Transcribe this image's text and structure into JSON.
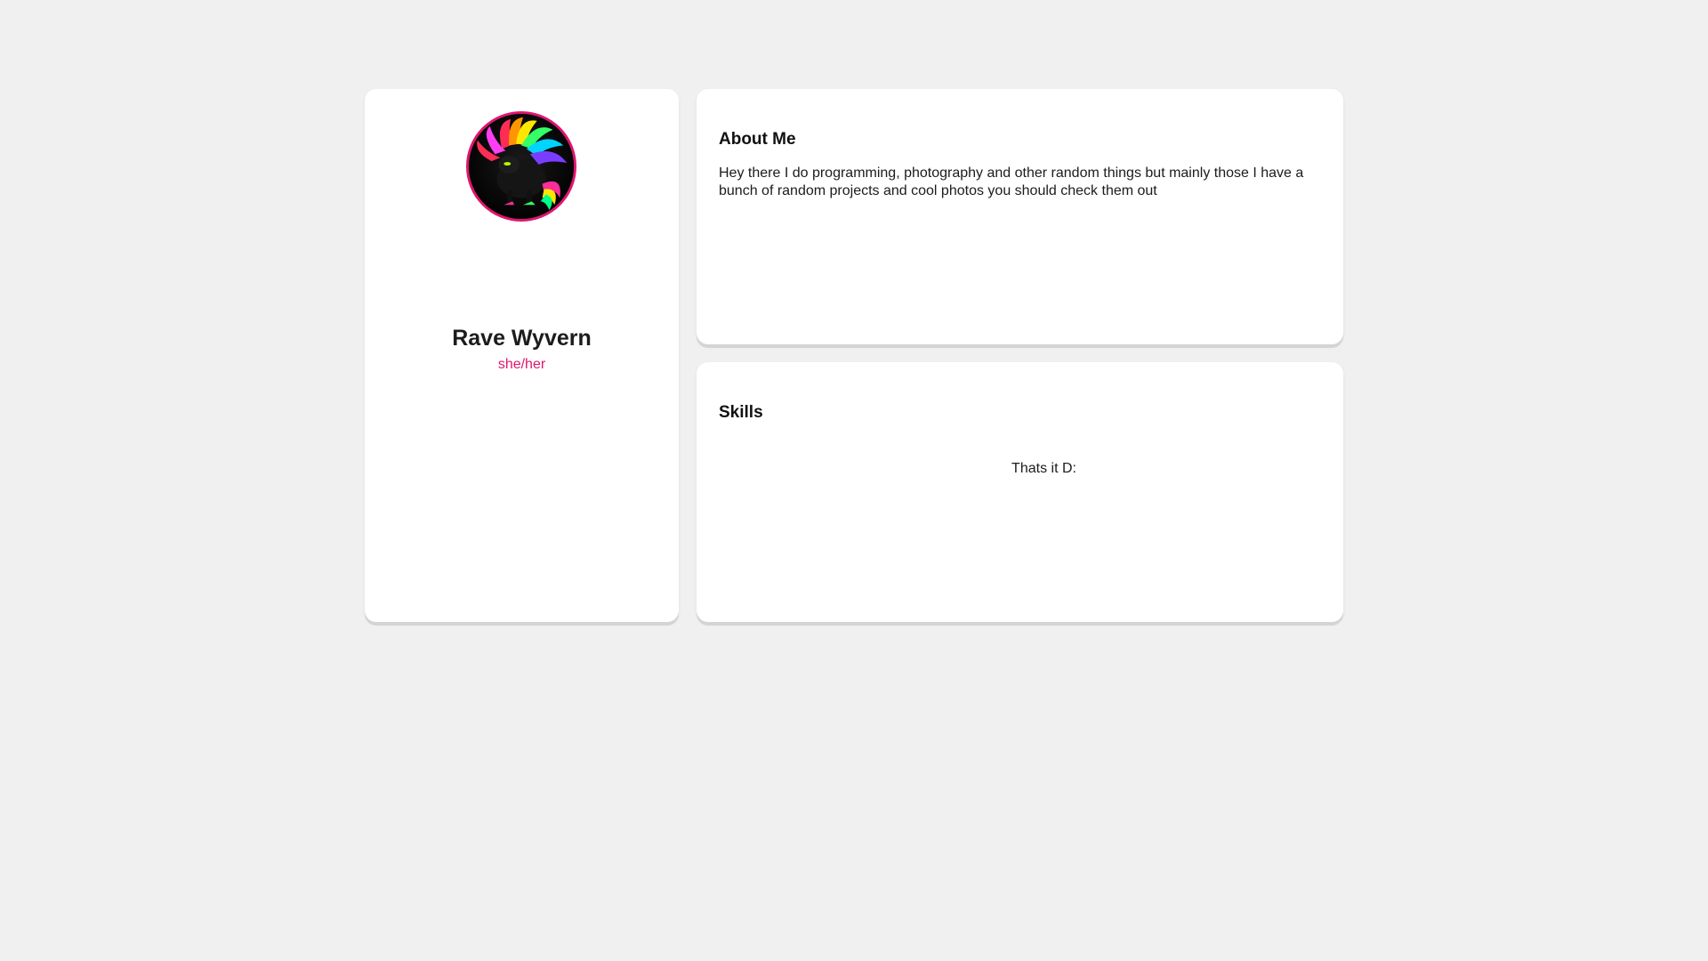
{
  "profile": {
    "name": "Rave Wyvern",
    "pronouns": "she/her",
    "avatar_icon": "rainbow-wyvern-avatar",
    "accent_color": "#e0156f"
  },
  "about": {
    "title": "About Me",
    "text": "Hey there I do programming, photography and other random things but mainly those I have a bunch of random projects and cool photos you should check them out"
  },
  "skills": {
    "title": "Skills",
    "empty_text": "Thats it D:"
  }
}
